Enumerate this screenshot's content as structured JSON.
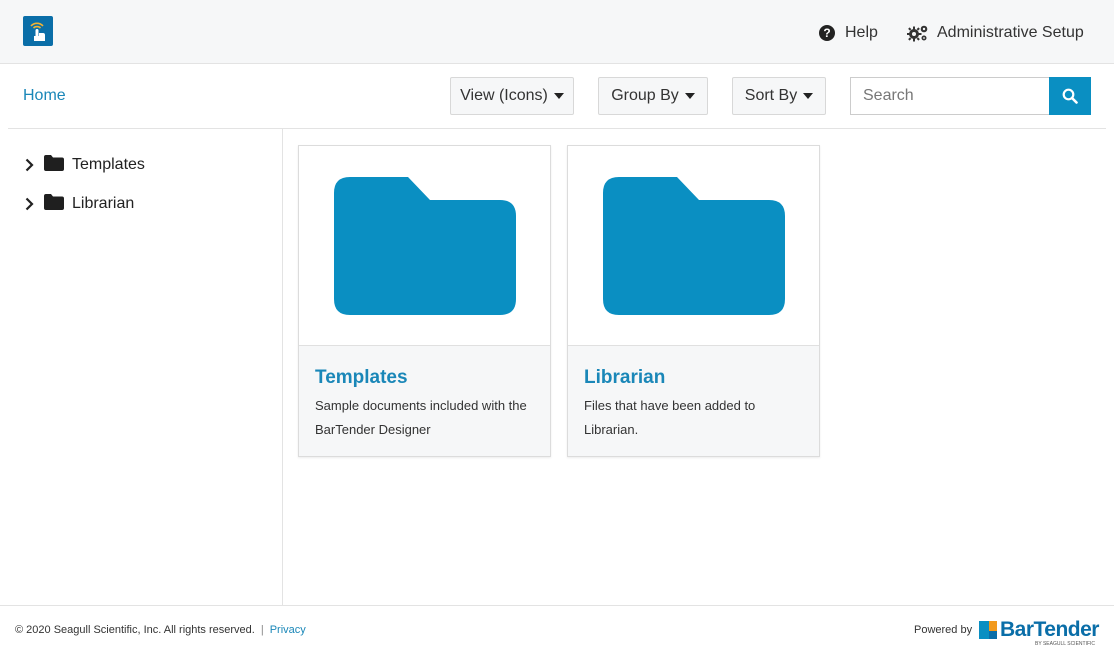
{
  "header": {
    "help_label": "Help",
    "admin_label": "Administrative Setup",
    "icons": {
      "logo": "print-portal-icon",
      "help": "question-circle-icon",
      "admin": "gears-icon"
    }
  },
  "toolbar": {
    "breadcrumb": "Home",
    "view_label": "View (Icons)",
    "group_label": "Group By",
    "sort_label": "Sort By",
    "search_placeholder": "Search",
    "search_icon": "search-icon"
  },
  "sidebar": {
    "items": [
      {
        "label": "Templates"
      },
      {
        "label": "Librarian"
      }
    ]
  },
  "main": {
    "cards": [
      {
        "title": "Templates",
        "description": "Sample documents included with the BarTender Designer"
      },
      {
        "title": "Librarian",
        "description": "Files that have been added to Librarian."
      }
    ]
  },
  "footer": {
    "copyright": "© 2020 Seagull Scientific, Inc. All rights reserved.",
    "separator": "|",
    "privacy": "Privacy",
    "powered_by": "Powered by",
    "brand": "BarTender",
    "brand_tagline": "BY SEAGULL SCIENTIFIC"
  },
  "colors": {
    "accent": "#1a87b8",
    "folder": "#0a8fc2",
    "brand_orange": "#f29a1d"
  }
}
